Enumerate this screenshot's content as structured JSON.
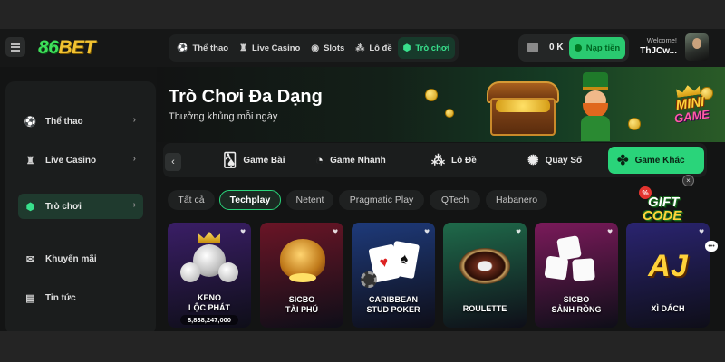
{
  "brand": {
    "logo_num": "86",
    "logo_text": "BET"
  },
  "topnav": [
    {
      "label": "Thể thao",
      "icon": "soccer-ball-icon"
    },
    {
      "label": "Live Casino",
      "icon": "casino-chip-icon"
    },
    {
      "label": "Slots",
      "icon": "slot-eye-icon"
    },
    {
      "label": "Lô đề",
      "icon": "lottery-balls-icon"
    },
    {
      "label": "Trò chơi",
      "icon": "dice-icon",
      "active": true
    }
  ],
  "wallet": {
    "balance": "0 K",
    "deposit_label": "Nạp tiền"
  },
  "user": {
    "welcome": "Welcome!",
    "name": "ThJCw..."
  },
  "sidebar": {
    "items": [
      {
        "label": "Thể thao",
        "icon": "soccer-ball-icon",
        "chevron": "›"
      },
      {
        "label": "Live Casino",
        "icon": "casino-chip-icon",
        "chevron": "›"
      },
      {
        "label": "Trò chơi",
        "icon": "dice-icon",
        "chevron": "›",
        "active": true
      },
      {
        "label": "Khuyến mãi",
        "icon": "gift-icon"
      },
      {
        "label": "Tin tức",
        "icon": "news-icon"
      }
    ]
  },
  "banner": {
    "title": "Trò Chơi Đa Dạng",
    "subtitle": "Thưởng khủng mỗi ngày",
    "badge_line1": "MINI",
    "badge_line2": "GAME"
  },
  "categories": {
    "prev_icon": "‹",
    "items": [
      {
        "label": "Game Bài",
        "icon": "playing-cards-icon"
      },
      {
        "label": "Game Nhanh",
        "icon": "speedometer-icon"
      },
      {
        "label": "Lô Đề",
        "icon": "lottery-balls-icon"
      },
      {
        "label": "Quay Số",
        "icon": "spinner-icon"
      },
      {
        "label": "Game Khác",
        "icon": "puzzle-icon",
        "active": true
      }
    ]
  },
  "providers": [
    {
      "label": "Tất cả"
    },
    {
      "label": "Techplay",
      "active": true
    },
    {
      "label": "Netent"
    },
    {
      "label": "Pragmatic Play"
    },
    {
      "label": "QTech"
    },
    {
      "label": "Habanero"
    }
  ],
  "games": [
    {
      "line1": "KENO",
      "line2": "LỘC PHÁT",
      "jackpot": "8,838,247,000",
      "bg": "#3a1e66"
    },
    {
      "line1": "SICBO",
      "line2": "TÀI PHÚ",
      "bg": "#6a1526"
    },
    {
      "line1": "CARIBBEAN",
      "line2": "STUD POKER",
      "bg": "#1e3a7a"
    },
    {
      "line1": "ROULETTE",
      "line2": "",
      "bg": "#1f6a4a"
    },
    {
      "line1": "SICBO",
      "line2": "SẢNH RỒNG",
      "bg": "#7a1a5a"
    },
    {
      "line1": "XÌ DÁCH",
      "line2": "",
      "bg": "#2a2470"
    }
  ],
  "gift": {
    "line1": "GIFT",
    "line2": "CODE",
    "tag": "%",
    "close": "×"
  },
  "icons": {
    "heart": "♥",
    "chat": "•••"
  },
  "colors": {
    "accent": "#2ad47a",
    "active_text": "#38e08c",
    "gold": "#f1c232"
  }
}
